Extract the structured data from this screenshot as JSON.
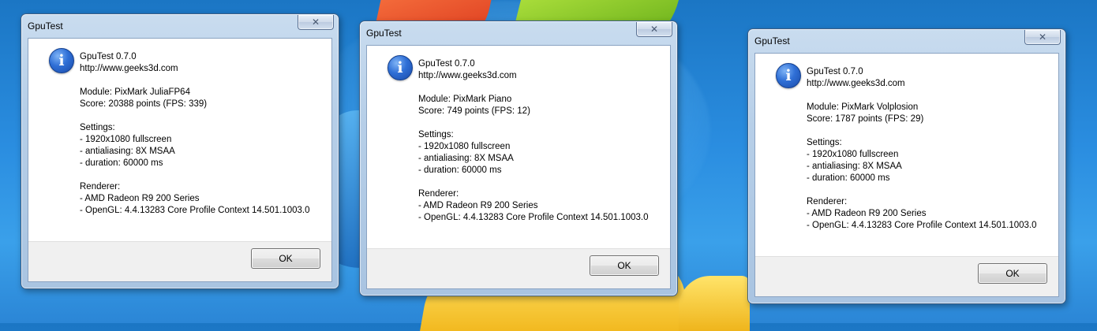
{
  "dialogs": [
    {
      "title": "GpuTest",
      "close_label": "✕",
      "ok_label": "OK",
      "lines": [
        "GpuTest 0.7.0",
        "http://www.geeks3d.com",
        "",
        "Module: PixMark JuliaFP64",
        "Score: 20388 points (FPS: 339)",
        "",
        "Settings:",
        "- 1920x1080 fullscreen",
        "- antialiasing: 8X MSAA",
        "- duration: 60000 ms",
        "",
        "Renderer:",
        "- AMD Radeon R9 200 Series",
        "- OpenGL: 4.4.13283 Core Profile Context 14.501.1003.0"
      ]
    },
    {
      "title": "GpuTest",
      "close_label": "✕",
      "ok_label": "OK",
      "lines": [
        "GpuTest 0.7.0",
        "http://www.geeks3d.com",
        "",
        "Module: PixMark Piano",
        "Score: 749 points (FPS: 12)",
        "",
        "Settings:",
        "- 1920x1080 fullscreen",
        "- antialiasing: 8X MSAA",
        "- duration: 60000 ms",
        "",
        "Renderer:",
        "- AMD Radeon R9 200 Series",
        "- OpenGL: 4.4.13283 Core Profile Context 14.501.1003.0"
      ]
    },
    {
      "title": "GpuTest",
      "close_label": "✕",
      "ok_label": "OK",
      "lines": [
        "GpuTest 0.7.0",
        "http://www.geeks3d.com",
        "",
        "Module: PixMark Volplosion",
        "Score: 1787 points (FPS: 29)",
        "",
        "Settings:",
        "- 1920x1080 fullscreen",
        "- antialiasing: 8X MSAA",
        "- duration: 60000 ms",
        "",
        "Renderer:",
        "- AMD Radeon R9 200 Series",
        "- OpenGL: 4.4.13283 Core Profile Context 14.501.1003.0"
      ]
    }
  ],
  "icons": {
    "dialog_icon": "information-icon",
    "close_icon": "close-icon"
  }
}
